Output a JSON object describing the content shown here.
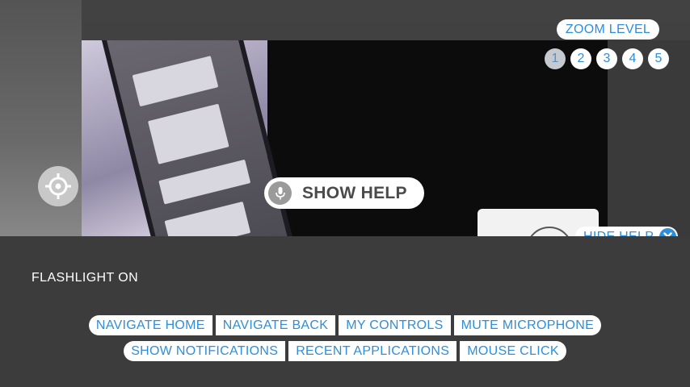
{
  "zoom": {
    "label": "ZOOM LEVEL",
    "levels": [
      "1",
      "2",
      "3",
      "4",
      "5"
    ],
    "active_level": 1
  },
  "show_help": {
    "label": "SHOW HELP"
  },
  "hide_help": {
    "label": "HIDE HELP"
  },
  "status": {
    "flashlight": "FLASHLIGHT ON"
  },
  "commands": {
    "row1": [
      "NAVIGATE HOME",
      "NAVIGATE BACK",
      "MY CONTROLS",
      "MUTE MICROPHONE"
    ],
    "row2": [
      "SHOW NOTIFICATIONS",
      "RECENT APPLICATIONS",
      "MOUSE CLICK"
    ]
  },
  "icons": {
    "crosshair": "crosshair-icon",
    "microphone": "microphone-icon",
    "close": "close-icon"
  },
  "colors": {
    "accent": "#2e8ed8",
    "panel": "#3c3c3c",
    "pill": "#ffffff"
  }
}
